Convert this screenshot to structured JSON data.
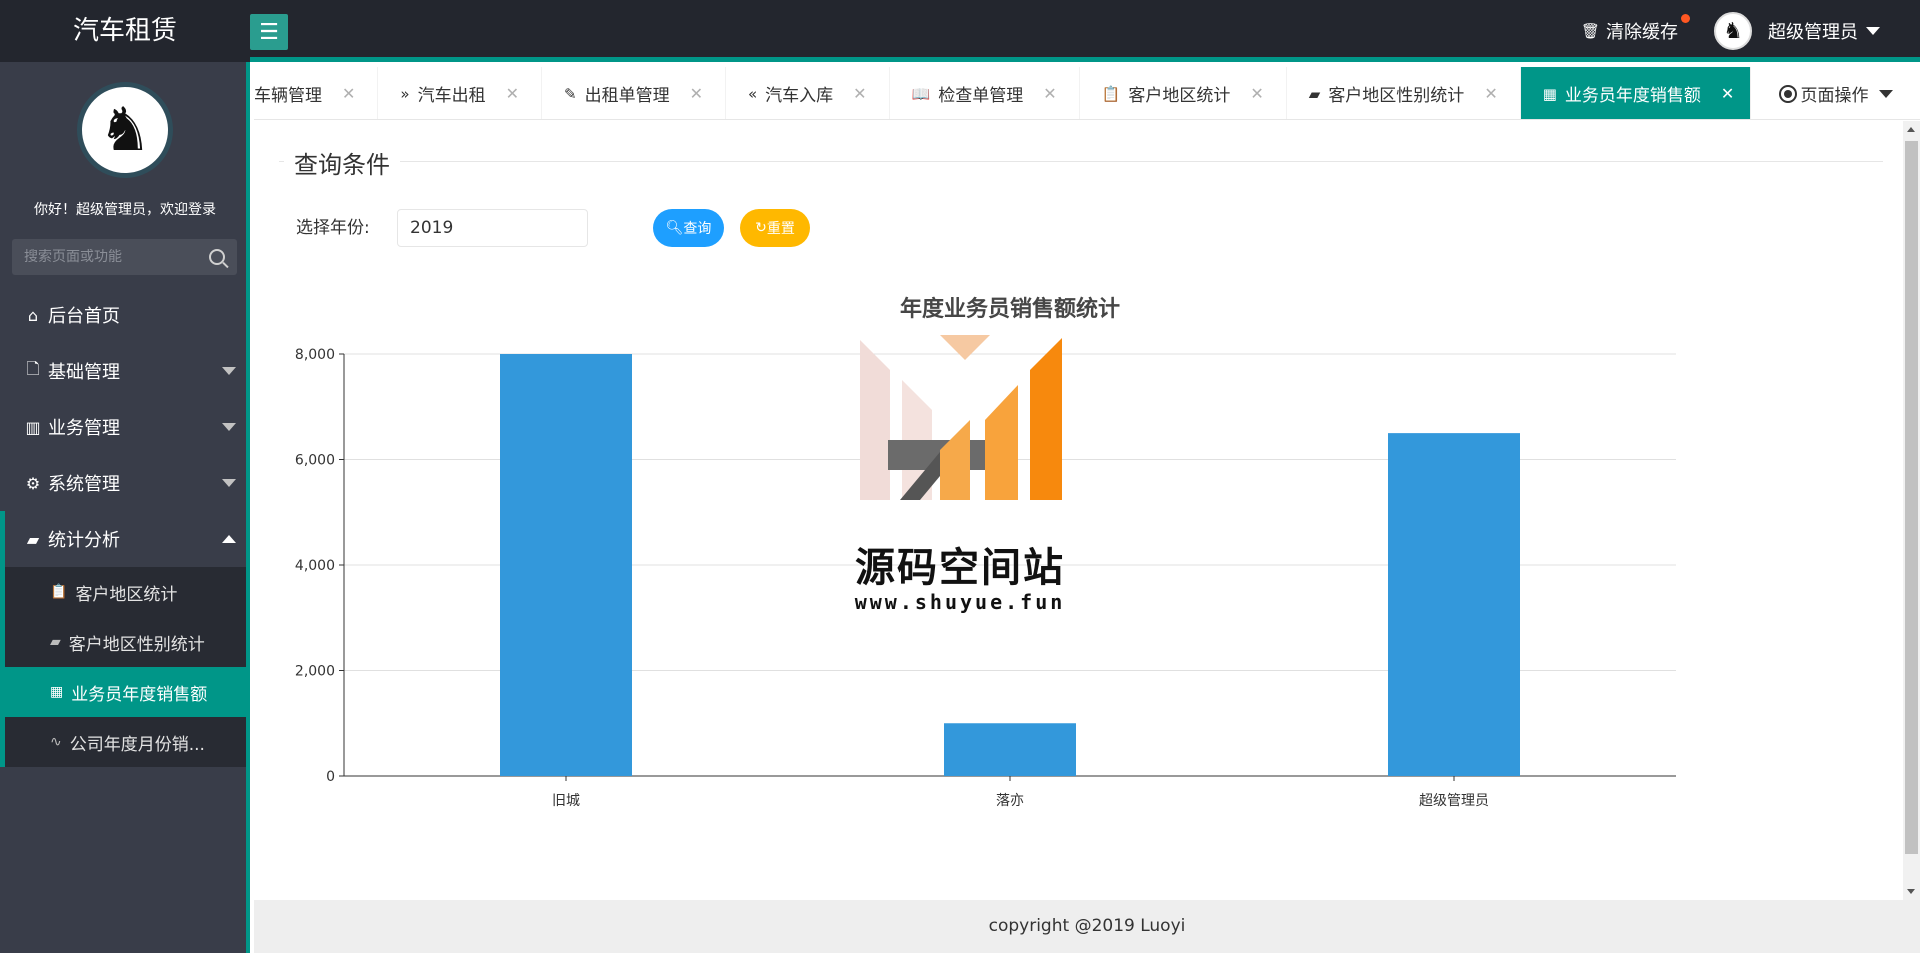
{
  "app": {
    "title": "汽车租赁"
  },
  "header": {
    "clear_cache": "清除缓存",
    "user_name": "超级管理员"
  },
  "sidebar": {
    "welcome": "你好！超级管理员，欢迎登录",
    "search_placeholder": "搜索页面或功能",
    "items": [
      {
        "label": "后台首页",
        "icon": "home-icon"
      },
      {
        "label": "基础管理",
        "icon": "file-icon"
      },
      {
        "label": "业务管理",
        "icon": "building-icon"
      },
      {
        "label": "系统管理",
        "icon": "gear-icon"
      },
      {
        "label": "统计分析",
        "icon": "chart-screen-icon"
      }
    ],
    "sub_items": [
      {
        "label": "客户地区统计",
        "icon": "clipboard-icon"
      },
      {
        "label": "客户地区性别统计",
        "icon": "chart-screen-icon"
      },
      {
        "label": "业务员年度销售额",
        "icon": "table-icon"
      },
      {
        "label": "公司年度月份销...",
        "icon": "pulse-icon"
      }
    ]
  },
  "tabs": [
    {
      "label": "车辆管理"
    },
    {
      "label": "汽车出租"
    },
    {
      "label": "出租单管理"
    },
    {
      "label": "汽车入库"
    },
    {
      "label": "检查单管理"
    },
    {
      "label": "客户地区统计"
    },
    {
      "label": "客户地区性别统计"
    },
    {
      "label": "业务员年度销售额"
    }
  ],
  "page_op": "页面操作",
  "query": {
    "legend": "查询条件",
    "year_label": "选择年份:",
    "year_value": "2019",
    "query_btn": "查询",
    "reset_btn": "重置"
  },
  "chart_data": {
    "type": "bar",
    "title": "年度业务员销售额统计",
    "categories": [
      "旧城",
      "落亦",
      "超级管理员"
    ],
    "values": [
      8000,
      1000,
      6500
    ],
    "ylim": [
      0,
      8000
    ],
    "yticks": [
      0,
      2000,
      4000,
      6000,
      8000
    ],
    "ytick_labels": [
      "0",
      "2,000",
      "4,000",
      "6,000",
      "8,000"
    ],
    "grid": true,
    "color": "#3398db"
  },
  "watermark": {
    "text": "源码空间站",
    "url": "www.shuyue.fun"
  },
  "footer": {
    "copyright": "copyright @2019 Luoyi"
  }
}
